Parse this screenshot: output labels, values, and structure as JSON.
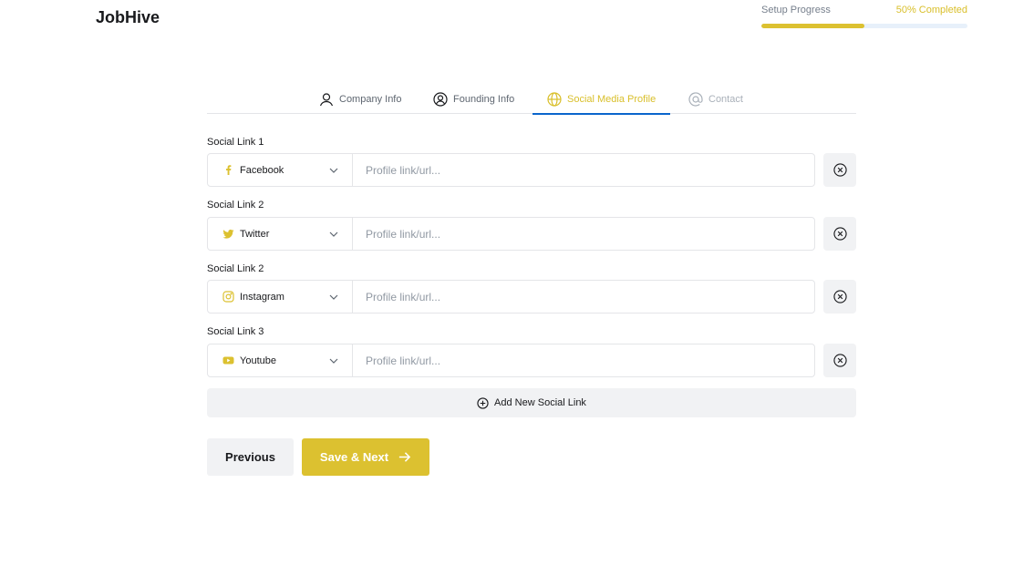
{
  "brand": {
    "name": "JobHive"
  },
  "progress": {
    "label": "Setup Progress",
    "percent_text": "50% Completed",
    "value": 0.5
  },
  "tabs": [
    {
      "label": "Company Info",
      "icon": "user-icon",
      "state": "done"
    },
    {
      "label": "Founding Info",
      "icon": "user-circle-icon",
      "state": "done"
    },
    {
      "label": "Social Media Profile",
      "icon": "globe-icon",
      "state": "active"
    },
    {
      "label": "Contact",
      "icon": "at-icon",
      "state": "disabled"
    }
  ],
  "social_links": [
    {
      "label": "Social Link 1",
      "platform": "Facebook",
      "icon": "facebook-icon",
      "placeholder": "Profile link/url..."
    },
    {
      "label": "Social Link 2",
      "platform": "Twitter",
      "icon": "twitter-icon",
      "placeholder": "Profile link/url..."
    },
    {
      "label": "Social Link 2",
      "platform": "Instagram",
      "icon": "instagram-icon",
      "placeholder": "Profile link/url..."
    },
    {
      "label": "Social Link 3",
      "platform": "Youtube",
      "icon": "youtube-icon",
      "placeholder": "Profile link/url..."
    }
  ],
  "actions": {
    "add_label": "Add New Social Link",
    "previous_label": "Previous",
    "next_label": "Save & Next"
  },
  "colors": {
    "accent": "#dcc130",
    "accent_text": "#d9bf2a",
    "active_tab_underline": "#0a65cc",
    "button_gray": "#f1f2f4",
    "border": "#e4e5e8"
  }
}
